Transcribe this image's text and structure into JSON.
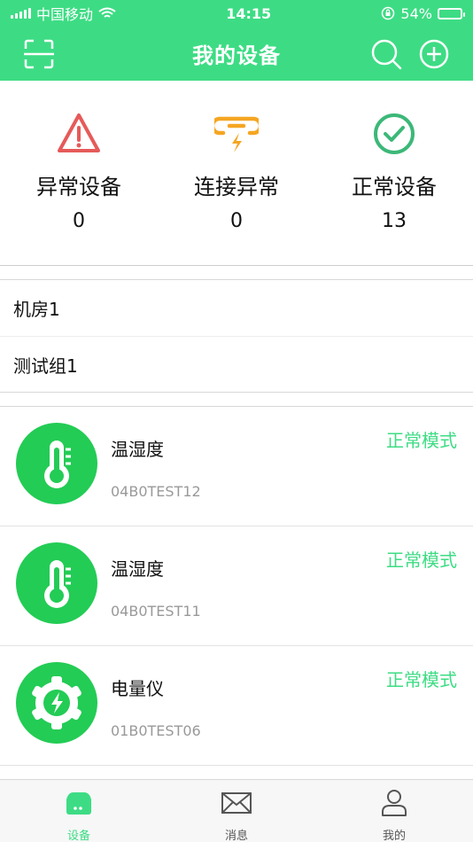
{
  "status_bar": {
    "carrier": "中国移动",
    "time": "14:15",
    "battery_text": "54%",
    "battery_level": 0.54
  },
  "header": {
    "title": "我的设备",
    "left_icon": "scan-icon",
    "right_icons": [
      "search-icon",
      "add-icon"
    ]
  },
  "summary": [
    {
      "label": "异常设备",
      "count": "0",
      "icon": "warning-icon",
      "color": "#e65a5a"
    },
    {
      "label": "连接异常",
      "count": "0",
      "icon": "link-broken-icon",
      "color": "#f5a623"
    },
    {
      "label": "正常设备",
      "count": "13",
      "icon": "check-circle-icon",
      "color": "#3cb878"
    }
  ],
  "groups": [
    {
      "label": "机房1"
    },
    {
      "label": "测试组1"
    }
  ],
  "devices": [
    {
      "name": "温湿度",
      "id": "04B0TEST12",
      "mode": "正常模式",
      "icon": "thermometer-icon"
    },
    {
      "name": "温湿度",
      "id": "04B0TEST11",
      "mode": "正常模式",
      "icon": "thermometer-icon"
    },
    {
      "name": "电量仪",
      "id": "01B0TEST06",
      "mode": "正常模式",
      "icon": "power-gear-icon"
    }
  ],
  "tabs": [
    {
      "label": "设备",
      "icon": "device-icon",
      "active": true
    },
    {
      "label": "消息",
      "icon": "mail-icon",
      "active": false
    },
    {
      "label": "我的",
      "icon": "user-icon",
      "active": false
    }
  ],
  "colors": {
    "brand_green": "#3ddc84",
    "avatar_green": "#23cc55",
    "warning_red": "#e65a5a",
    "link_orange": "#f5a623",
    "ok_green": "#3cb878"
  }
}
